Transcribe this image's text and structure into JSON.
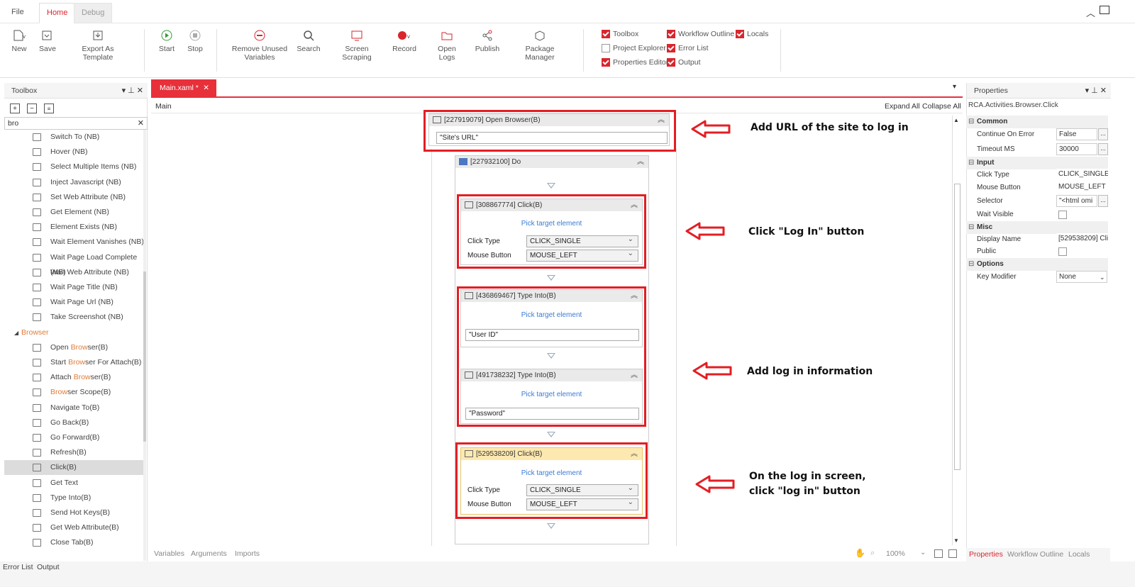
{
  "menu": {
    "file": "File",
    "home": "Home",
    "debug": "Debug"
  },
  "ribbon": {
    "new": "New",
    "save": "Save",
    "export": "Export As Template",
    "start": "Start",
    "stop": "Stop",
    "remove_unused_1": "Remove Unused",
    "remove_unused_2": "Variables",
    "search": "Search",
    "screen_scraping": "Screen Scraping",
    "record": "Record",
    "open_logs": "Open Logs",
    "publish": "Publish",
    "package_manager": "Package Manager",
    "checks": {
      "toolbox": "Toolbox",
      "workflow_outline": "Workflow Outline",
      "locals": "Locals",
      "project_explorer": "Project Explorer",
      "error_list": "Error List",
      "properties_editor": "Properties Editor",
      "output": "Output"
    }
  },
  "toolbox": {
    "title": "Toolbox",
    "search_value": "bro",
    "items_nb": [
      "Switch To (NB)",
      "Hover (NB)",
      "Select Multiple Items (NB)",
      "Inject Javascript (NB)",
      "Set Web Attribute (NB)",
      "Get Element (NB)",
      "Element Exists (NB)",
      "Wait Element Vanishes (NB)",
      "Wait Page Load Complete (NB)",
      "Wait Web Attribute (NB)",
      "Wait Page Title (NB)",
      "Wait Page Url (NB)",
      "Take Screenshot (NB)"
    ],
    "category": "Browser",
    "items_b": [
      {
        "pre": "Open ",
        "hl": "Brow",
        "post": "ser(B)"
      },
      {
        "pre": "Start ",
        "hl": "Brow",
        "post": "ser For Attach(B)"
      },
      {
        "pre": "Attach ",
        "hl": "Brow",
        "post": "ser(B)"
      },
      {
        "pre": "",
        "hl": "Brow",
        "post": "ser Scope(B)"
      },
      {
        "pre": "Navigate To(B)",
        "hl": "",
        "post": ""
      },
      {
        "pre": "Go Back(B)",
        "hl": "",
        "post": ""
      },
      {
        "pre": "Go Forward(B)",
        "hl": "",
        "post": ""
      },
      {
        "pre": "Refresh(B)",
        "hl": "",
        "post": ""
      },
      {
        "pre": "Click(B)",
        "hl": "",
        "post": ""
      },
      {
        "pre": "Get Text",
        "hl": "",
        "post": ""
      },
      {
        "pre": "Type Into(B)",
        "hl": "",
        "post": ""
      },
      {
        "pre": "Send Hot Keys(B)",
        "hl": "",
        "post": ""
      },
      {
        "pre": "Get Web Attribute(B)",
        "hl": "",
        "post": ""
      },
      {
        "pre": "Close Tab(B)",
        "hl": "",
        "post": ""
      }
    ]
  },
  "doc": {
    "tab": "Main.xaml *",
    "breadcrumb": "Main",
    "expand_all": "Expand All",
    "collapse_all": "Collapse All"
  },
  "workflow": {
    "open_browser": "[227919079] Open Browser(B)",
    "url": "\"Site's URL\"",
    "do": "[227932100] Do",
    "click1": "[308867774] Click(B)",
    "type1": "[436869467] Type Into(B)",
    "user_id": "\"User ID\"",
    "type2": "[491738232] Type Into(B)",
    "password": "\"Password\"",
    "click2": "[529538209] Click(B)",
    "pick": "Pick target element",
    "click_type_label": "Click Type",
    "mouse_button_label": "Mouse Button",
    "click_single": "CLICK_SINGLE",
    "mouse_left": "MOUSE_LEFT"
  },
  "annotations": {
    "a1": "Add URL of the site to log in",
    "a2": "Click \"Log In\" button",
    "a3": "Add log in information",
    "a4_1": "On the log in screen,",
    "a4_2": "click \"log in\" button"
  },
  "properties": {
    "title": "Properties",
    "type_name": "RCA.Activities.Browser.Click",
    "cat_common": "Common",
    "cat_input": "Input",
    "cat_misc": "Misc",
    "cat_options": "Options",
    "continue_on_error": "Continue On Error",
    "continue_on_error_val": "False",
    "timeout": "Timeout MS",
    "timeout_val": "30000",
    "click_type": "Click Type",
    "click_type_val": "CLICK_SINGLE",
    "mouse_button": "Mouse Button",
    "mouse_button_val": "MOUSE_LEFT",
    "selector": "Selector",
    "selector_val": "\"<html omi",
    "wait_visible": "Wait Visible",
    "display_name": "Display Name",
    "display_name_val": "[529538209] Clic",
    "public": "Public",
    "key_modifier": "Key Modifier",
    "key_modifier_val": "None"
  },
  "bottom": {
    "variables": "Variables",
    "arguments": "Arguments",
    "imports": "Imports",
    "zoom": "100%",
    "tab_properties": "Properties",
    "tab_outline": "Workflow Outline",
    "tab_locals": "Locals",
    "error_list": "Error List",
    "output": "Output"
  },
  "colors": {
    "accent": "#d9262e",
    "annotation": "#e31e24"
  }
}
